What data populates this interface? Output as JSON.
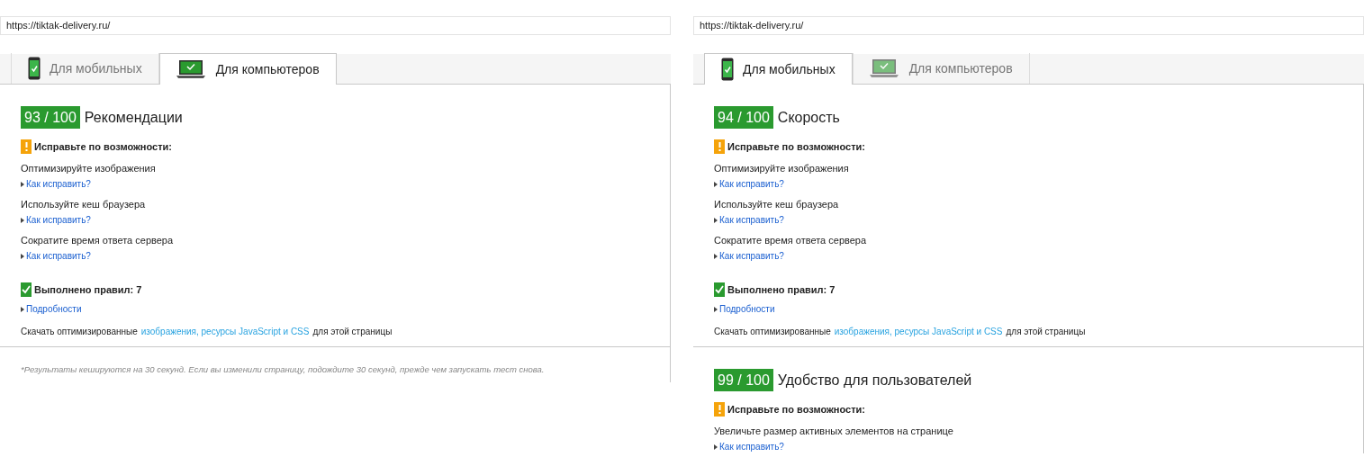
{
  "panels": [
    {
      "url": "https://tiktak-delivery.ru/",
      "tabs": [
        {
          "label": "Для мобильных",
          "kind": "mobile",
          "selected": false
        },
        {
          "label": "Для компьютеров",
          "kind": "desktop",
          "selected": true
        }
      ],
      "sections": [
        {
          "score": "93 / 100",
          "title": "Рекомендации",
          "warning": "Исправьте по возможности:",
          "issues": [
            {
              "text": "Оптимизируйте изображения",
              "link": "Как исправить?"
            },
            {
              "text": "Используйте кеш браузера",
              "link": "Как исправить?"
            },
            {
              "text": "Сократите время ответа сервера",
              "link": "Как исправить?"
            }
          ],
          "passed": "Выполнено правил: 7",
          "details_link": "Подробности",
          "download": {
            "before": "Скачать оптимизированные",
            "link": "изображения, ресурсы JavaScript и CSS",
            "after": "для этой страницы"
          }
        }
      ],
      "footnote": "*Результаты кешируются на 30 секунд. Если вы изменили страницу, подождите 30 секунд, прежде чем запускать тест снова."
    },
    {
      "url": "https://tiktak-delivery.ru/",
      "tabs": [
        {
          "label": "Для мобильных",
          "kind": "mobile",
          "selected": true
        },
        {
          "label": "Для компьютеров",
          "kind": "desktop",
          "selected": false
        }
      ],
      "sections": [
        {
          "score": "94 / 100",
          "title": "Скорость",
          "warning": "Исправьте по возможности:",
          "issues": [
            {
              "text": "Оптимизируйте изображения",
              "link": "Как исправить?"
            },
            {
              "text": "Используйте кеш браузера",
              "link": "Как исправить?"
            },
            {
              "text": "Сократите время ответа сервера",
              "link": "Как исправить?"
            }
          ],
          "passed": "Выполнено правил: 7",
          "details_link": "Подробности",
          "download": {
            "before": "Скачать оптимизированные",
            "link": "изображения, ресурсы JavaScript и CSS",
            "after": "для этой страницы"
          }
        },
        {
          "score": "99 / 100",
          "title": "Удобство для пользователей",
          "warning": "Исправьте по возможности:",
          "issues": [
            {
              "text": "Увеличьте размер активных элементов на странице",
              "link": "Как исправить?"
            }
          ]
        }
      ]
    }
  ]
}
